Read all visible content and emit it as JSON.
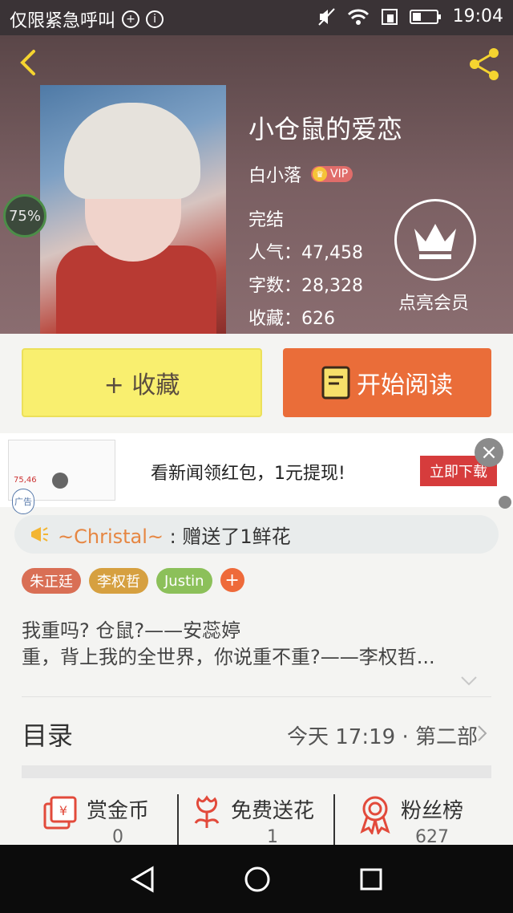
{
  "status_bar": {
    "carrier_text": "仅限紧急呼叫",
    "time": "19:04"
  },
  "book": {
    "title": "小仓鼠的爱恋",
    "author": "白小落",
    "vip_label": "VIP",
    "status": "完结",
    "popularity": "人气：47,458",
    "word_count": "字数：28,328",
    "favorites": "收藏：626",
    "read_progress": "75%"
  },
  "member": {
    "label": "点亮会员"
  },
  "buttons": {
    "favorite": "+ 收藏",
    "start_reading": "开始阅读"
  },
  "ad": {
    "thumb_number": "75,46",
    "tag": "广告",
    "text": "看新闻领红包，1元提现!",
    "cta": "立即下载"
  },
  "gift_notice": {
    "user": "~Christal~",
    "text": " : 赠送了1鲜花"
  },
  "tags": [
    {
      "label": "朱正廷",
      "color": "#d96f55"
    },
    {
      "label": "李权哲",
      "color": "#d6a040"
    },
    {
      "label": "Justin",
      "color": "#8cc05a"
    }
  ],
  "description": {
    "line1": "我重吗? 仓鼠?——安蕊婷",
    "line2": "重，背上我的全世界，你说重不重?——李权哲..."
  },
  "toc": {
    "title": "目录",
    "latest": "今天 17:19 · 第二部"
  },
  "actions": [
    {
      "label": "赏金币",
      "count": "0"
    },
    {
      "label": "免费送花",
      "count": "1"
    },
    {
      "label": "粉丝榜",
      "count": "627"
    }
  ],
  "colors": {
    "accent_orange": "#ea6d39",
    "favorite_yellow": "#f9ef6f",
    "icon_red": "#e24a3b"
  }
}
